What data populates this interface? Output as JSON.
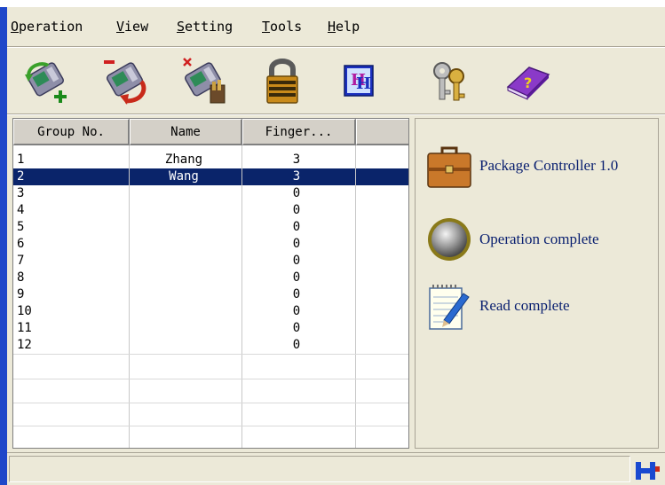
{
  "menu": [
    {
      "mnemonic": "O",
      "rest": "peration"
    },
    {
      "mnemonic": "V",
      "rest": "iew"
    },
    {
      "mnemonic": "S",
      "rest": "etting"
    },
    {
      "mnemonic": "T",
      "rest": "ools"
    },
    {
      "mnemonic": "H",
      "rest": "elp"
    }
  ],
  "toolbar": {
    "icons": [
      "add-device-icon",
      "remove-device-icon",
      "delete-device-icon",
      "lock-icon",
      "hh-logo-icon",
      "keys-icon",
      "help-book-icon"
    ],
    "logo_text": "H"
  },
  "table": {
    "columns": [
      "Group No.",
      "Name",
      "Finger..."
    ],
    "rows": [
      {
        "group": "1",
        "name": "Zhang",
        "finger": "3",
        "selected": false
      },
      {
        "group": "2",
        "name": "Wang",
        "finger": "3",
        "selected": true
      },
      {
        "group": "3",
        "name": "",
        "finger": "0",
        "selected": false
      },
      {
        "group": "4",
        "name": "",
        "finger": "0",
        "selected": false
      },
      {
        "group": "5",
        "name": "",
        "finger": "0",
        "selected": false
      },
      {
        "group": "6",
        "name": "",
        "finger": "0",
        "selected": false
      },
      {
        "group": "7",
        "name": "",
        "finger": "0",
        "selected": false
      },
      {
        "group": "8",
        "name": "",
        "finger": "0",
        "selected": false
      },
      {
        "group": "9",
        "name": "",
        "finger": "0",
        "selected": false
      },
      {
        "group": "10",
        "name": "",
        "finger": "0",
        "selected": false
      },
      {
        "group": "11",
        "name": "",
        "finger": "0",
        "selected": false
      },
      {
        "group": "12",
        "name": "",
        "finger": "0",
        "selected": false
      }
    ]
  },
  "status_panel": [
    {
      "icon": "briefcase-icon",
      "label": "Package Controller 1.0"
    },
    {
      "icon": "status-light-icon",
      "label": "Operation complete"
    },
    {
      "icon": "notepad-icon",
      "label": "Read complete"
    }
  ],
  "colors": {
    "selection": "#0a246a",
    "window_frame": "#1f47c9",
    "panel_text": "#0a2070"
  }
}
